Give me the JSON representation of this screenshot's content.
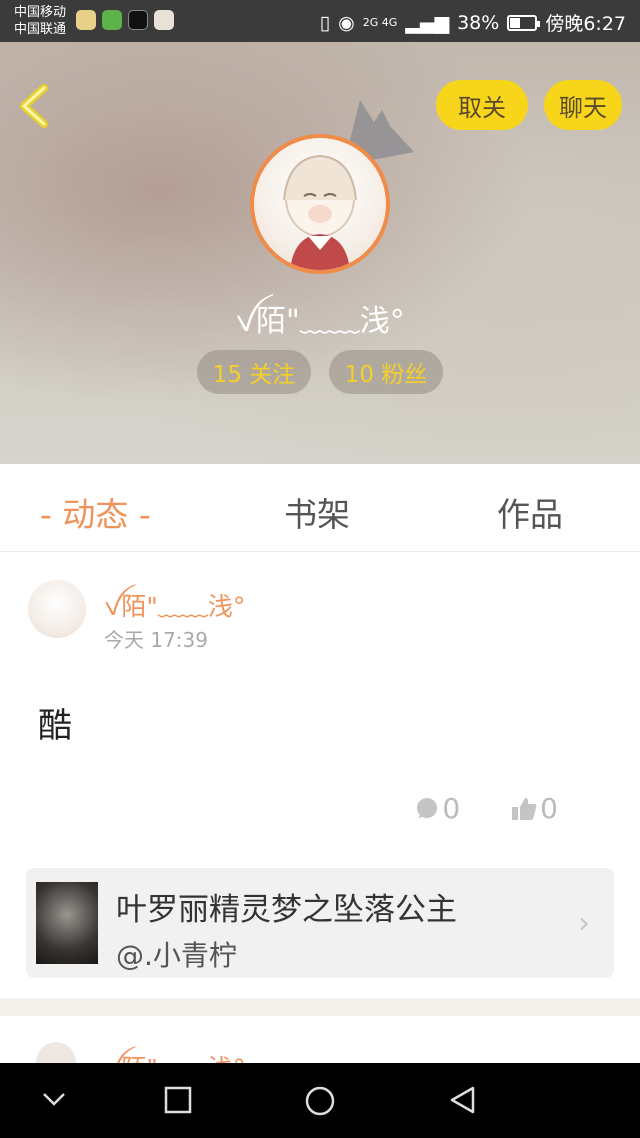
{
  "status_bar": {
    "carrier1": "中国移动",
    "carrier2": "中国联通",
    "signal": "2G 4G",
    "battery": "38%",
    "time": "傍晚6:27",
    "app_icons": [
      "wechat-icon",
      "green-app-icon",
      "tiktok-icon",
      "map-icon"
    ]
  },
  "profile": {
    "unfollow_label": "取关",
    "chat_label": "聊天",
    "username": "ꪜ陌\"﹏﹏浅°",
    "follows": "15 关注",
    "fans": "10 粉丝"
  },
  "tabs": [
    {
      "label": "- 动态 -",
      "active": true
    },
    {
      "label": "书架",
      "active": false
    },
    {
      "label": "作品",
      "active": false
    }
  ],
  "post": {
    "author": "ꪜ陌\"﹏﹏浅°",
    "time": "今天 17:39",
    "body": "酷",
    "comments": "0",
    "likes": "0",
    "book_title": "叶罗丽精灵梦之坠落公主",
    "book_author": "@.小青柠",
    "book_chevron": "›"
  },
  "post2": {
    "author": "ꪜ陌\"﹏﹏浅°"
  },
  "colors": {
    "accent": "#f0935a",
    "yellow": "#f7d51a",
    "avatar_border": "#f08b4a"
  }
}
